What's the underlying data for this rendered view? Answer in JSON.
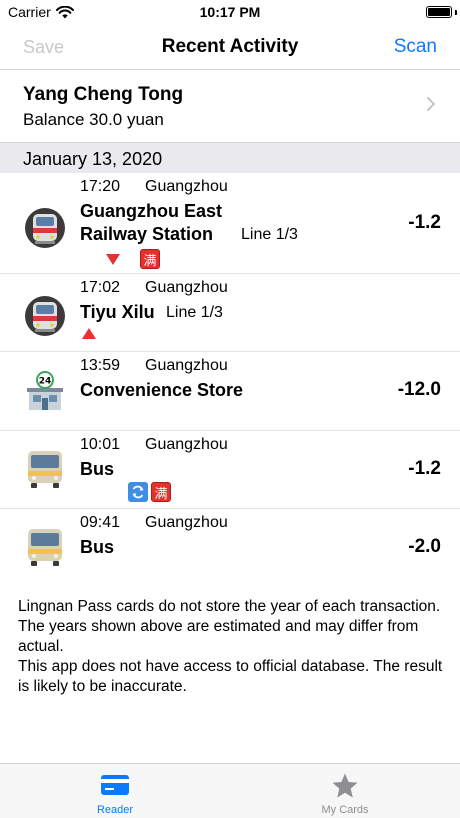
{
  "status_bar": {
    "carrier": "Carrier",
    "time": "10:17 PM"
  },
  "nav": {
    "save_label": "Save",
    "title": "Recent Activity",
    "scan_label": "Scan"
  },
  "card": {
    "name": "Yang Cheng Tong",
    "balance": "Balance 30.0 yuan"
  },
  "section": {
    "date": "January 13, 2020"
  },
  "transactions": [
    {
      "time": "17:20",
      "city": "Guangzhou",
      "name_line1": "Guangzhou East",
      "name_line2": "Railway Station",
      "line": "Line 1/3",
      "amount": "-1.2",
      "icon": "metro-train-icon",
      "badge": "满"
    },
    {
      "time": "17:02",
      "city": "Guangzhou",
      "name": "Tiyu Xilu",
      "line": "Line 1/3",
      "amount": "",
      "icon": "metro-train-icon"
    },
    {
      "time": "13:59",
      "city": "Guangzhou",
      "name": "Convenience Store",
      "amount": "-12.0",
      "icon": "convenience-store-icon"
    },
    {
      "time": "10:01",
      "city": "Guangzhou",
      "name": "Bus",
      "amount": "-1.2",
      "icon": "bus-icon",
      "badge": "满"
    },
    {
      "time": "09:41",
      "city": "Guangzhou",
      "name": "Bus",
      "amount": "-2.0",
      "icon": "bus-icon"
    }
  ],
  "footnote": {
    "line1": "Lingnan Pass cards do not store the year of each transaction. The years shown above are estimated and may differ from actual.",
    "line2": "This app does not have access to official database. The result is likely to be inaccurate."
  },
  "tabs": [
    {
      "label": "Reader",
      "icon": "card-icon",
      "active": true
    },
    {
      "label": "My Cards",
      "icon": "star-icon",
      "active": false
    }
  ],
  "colors": {
    "accent": "#0a7aff",
    "disabled": "#c8c8cc",
    "section_bg": "#e9e9ee",
    "badge_red": "#e3312d"
  }
}
